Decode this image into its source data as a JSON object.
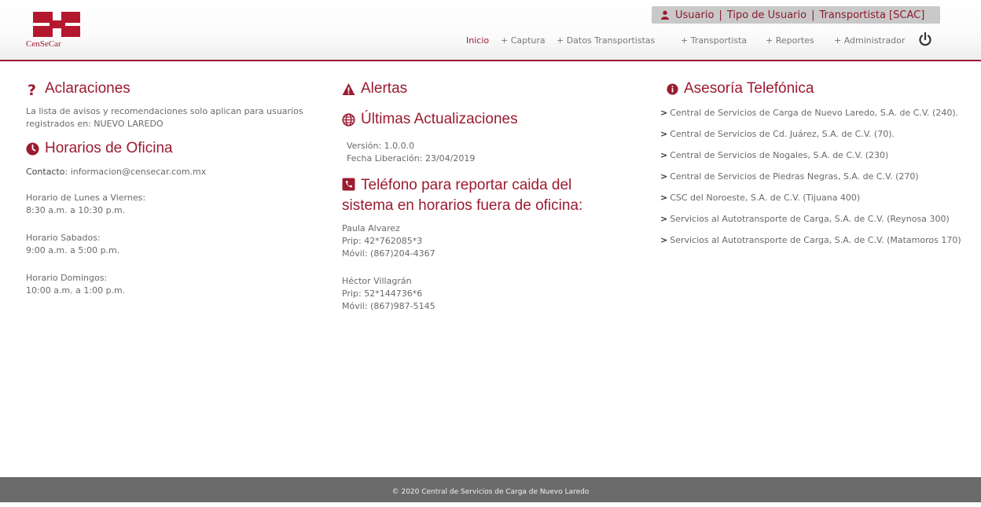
{
  "brand": {
    "logo_text": "CenSeCar"
  },
  "userbar": {
    "user": "Usuario",
    "type": "Tipo de Usuario",
    "role": "Transportista [SCAC]"
  },
  "nav": {
    "items": [
      "Inicio",
      "+ Captura",
      "+ Datos Transportistas",
      "+ Transportista",
      "+ Reportes",
      "+ Administrador"
    ]
  },
  "aclaraciones": {
    "title": "Aclaraciones",
    "text": "La lista de avisos y recomendaciones solo aplican para usuarios registrados en: NUEVO LAREDO"
  },
  "horarios": {
    "title": "Horarios de Oficina",
    "contact_label": "Contacto",
    "contact_value": ": informacion@censecar.com.mx",
    "weekdays_label": "Horario de Lunes a Viernes:",
    "weekdays_value": "8:30 a.m. a 10:30 p.m.",
    "saturday_label": "Horario Sabados:",
    "saturday_value": "9:00 a.m. a 5:00 p.m.",
    "sunday_label": "Horario Domingos:",
    "sunday_value": "10:00 a.m. a 1:00 p.m."
  },
  "alertas": {
    "title": "Alertas"
  },
  "updates": {
    "title": "Últimas Actualizaciones",
    "version": "Versión: 1.0.0.0",
    "release": "Fecha Liberación: 23/04/2019"
  },
  "phone": {
    "title": "Teléfono para reportar caida del sistema en horarios fuera de oficina:",
    "contacts": [
      {
        "name": "Paula Alvarez",
        "prip": "Prip: 42*762085*3",
        "mobile": "Móvil: (867)204-4367"
      },
      {
        "name": "Héctor Villagrán",
        "prip": "Prip: 52*144736*6",
        "mobile": "Móvil: (867)987-5145"
      }
    ]
  },
  "asesoria": {
    "title": "Asesoría Telefónica",
    "items": [
      "Central de Servicios de Carga de Nuevo Laredo, S.A. de C.V. (240).",
      "Central de Servicios de Cd. Juárez, S.A. de C.V. (70).",
      "Central de Servicios de Nogales, S.A. de C.V. (230)",
      "Central de Servicios de Piedras Negras, S.A. de C.V. (270)",
      "CSC del Noroeste, S.A. de C.V. (Tijuana 400)",
      "Servicios al Autotransporte de Carga, S.A. de C.V. (Reynosa 300)",
      "Servicios al Autotransporte de Carga, S.A. de C.V. (Matamoros 170)"
    ]
  },
  "footer": {
    "text": "© 2020 Central de Servicios de Carga de Nuevo Laredo"
  },
  "colors": {
    "brand": "#9b1b30",
    "footer": "#6b6b6b",
    "userbar": "#c9c9c9"
  },
  "icons": {
    "aclaraciones": "question-icon",
    "horarios": "clock-icon",
    "alertas": "warning-icon",
    "updates": "globe-icon",
    "phone": "phone-square-icon",
    "asesoria": "info-circle-icon",
    "user": "user-icon",
    "power": "power-icon"
  }
}
